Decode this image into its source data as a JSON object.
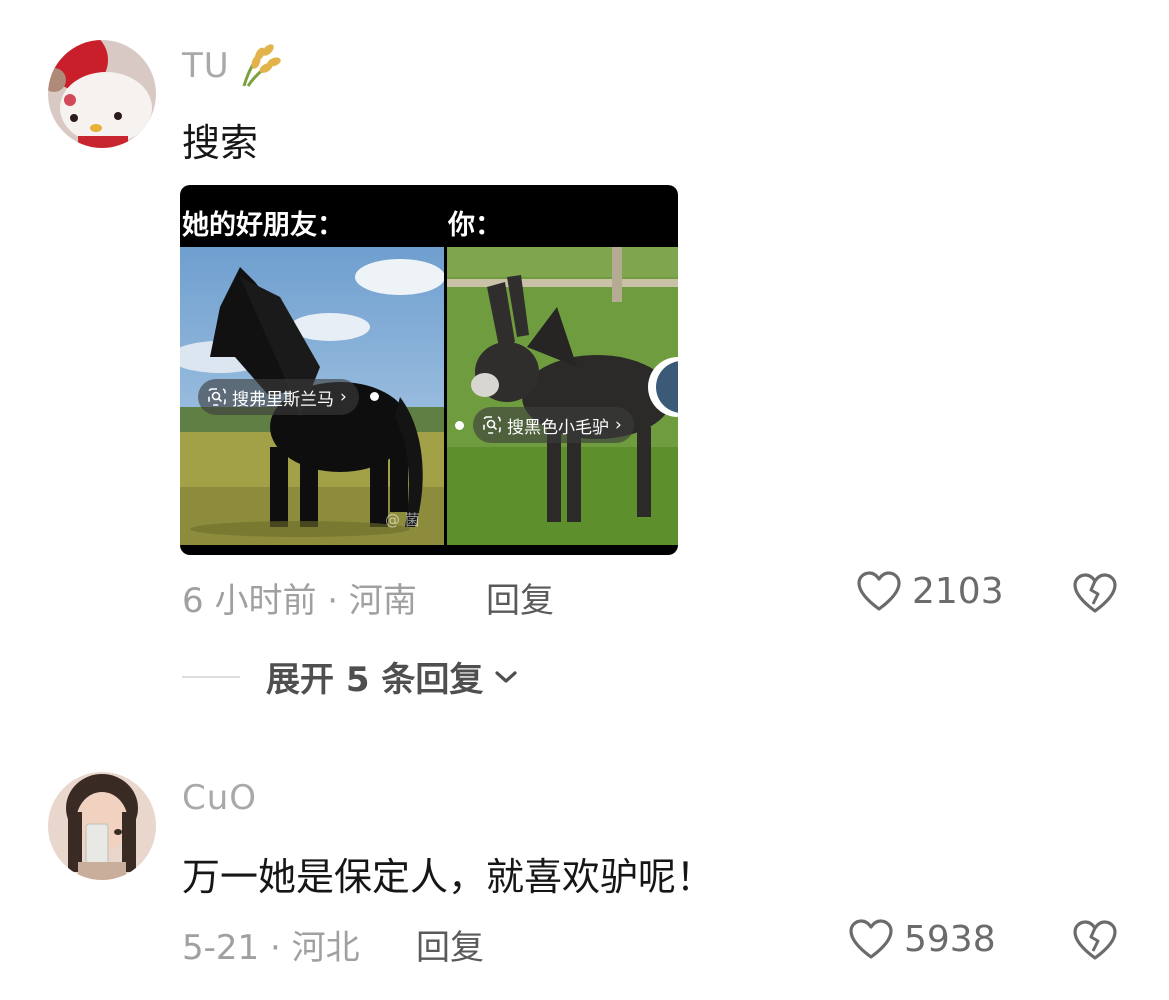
{
  "comments": [
    {
      "username": "TU",
      "text": "搜索",
      "image": {
        "left_caption": "她的好朋友：",
        "right_caption": "你：",
        "left_tag": "搜弗里斯兰马",
        "right_tag": "搜黑色小毛驴",
        "watermark": "@ 菌"
      },
      "time_location": "6 小时前 · 河南",
      "reply_label": "回复",
      "likes": "2103",
      "expand_label": "展开 5 条回复"
    },
    {
      "username": "CuO",
      "text": "万一她是保定人，就喜欢驴呢！",
      "time_location": "5-21 · 河北",
      "reply_label": "回复",
      "likes": "5938"
    }
  ],
  "icons": [
    "rice-emoji-icon",
    "heart-icon",
    "broken-heart-icon",
    "chevron-down-icon",
    "image-search-icon"
  ]
}
